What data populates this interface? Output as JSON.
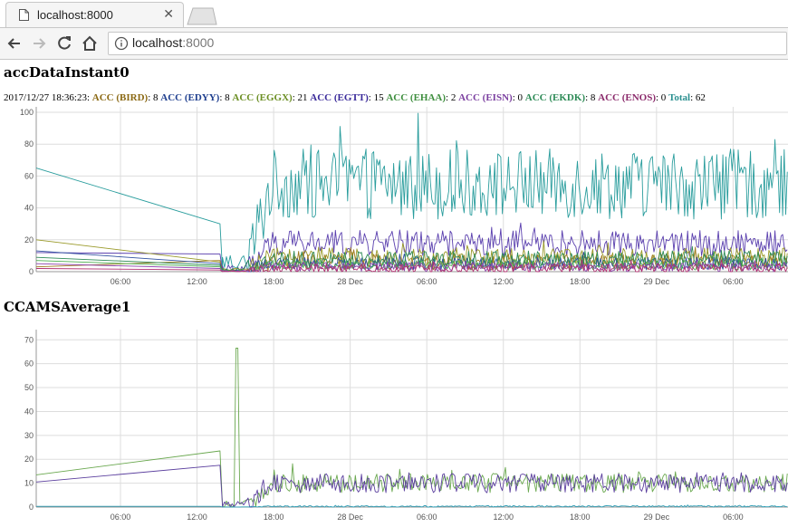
{
  "browser": {
    "tab_title": "localhost:8000",
    "url_host": "localhost",
    "url_port": ":8000"
  },
  "charts": {
    "instant": {
      "title": "accDataInstant0",
      "legend_time": "2017/12/27 18:36:23",
      "legend": [
        {
          "label": "ACC (BIRD)",
          "value": "8",
          "color": "#8b6914"
        },
        {
          "label": "ACC (EDYY)",
          "value": "8",
          "color": "#1f3f8f"
        },
        {
          "label": "ACC (EGGX)",
          "value": "21",
          "color": "#6b8e23"
        },
        {
          "label": "ACC (EGTT)",
          "value": "15",
          "color": "#3a2a9a"
        },
        {
          "label": "ACC (EHAA)",
          "value": "2",
          "color": "#3e8e3e"
        },
        {
          "label": "ACC (EISN)",
          "value": "0",
          "color": "#7b3fa0"
        },
        {
          "label": "ACC (EKDK)",
          "value": "8",
          "color": "#2e8b57"
        },
        {
          "label": "ACC (ENOS)",
          "value": "0",
          "color": "#8b2a6b"
        },
        {
          "label": "Total",
          "value": "62",
          "color": "#2a8f8f"
        }
      ]
    },
    "average": {
      "title": "CCAMSAverage1"
    }
  },
  "chart_data": [
    {
      "type": "line",
      "title": "accDataInstant0",
      "xlabel": "",
      "ylabel": "",
      "x_ticks": [
        "06:00",
        "12:00",
        "18:00",
        "28 Dec",
        "06:00",
        "12:00",
        "18:00",
        "29 Dec",
        "06:00"
      ],
      "x_tick_hours": [
        6,
        12,
        18,
        24,
        30,
        36,
        42,
        48,
        54
      ],
      "xlim": [
        -0.6,
        58.3
      ],
      "ylim": [
        0,
        100
      ],
      "y_ticks": [
        0,
        20,
        40,
        60,
        80,
        100
      ],
      "grid": true,
      "series": [
        {
          "name": "Total",
          "color": "#2a9d9d",
          "start": 65,
          "gap_end": 30,
          "mean": 55,
          "amp": 22,
          "ramp": 50
        },
        {
          "name": "ACC (EGTT)",
          "color": "#5a3fae",
          "start": 12,
          "gap_end": 11,
          "mean": 18,
          "amp": 8,
          "ramp": 18
        },
        {
          "name": "ACC (EGGX)",
          "color": "#9a9a2a",
          "start": 20,
          "gap_end": 6,
          "mean": 9,
          "amp": 6,
          "ramp": 9
        },
        {
          "name": "ACC (BIRD)",
          "color": "#a07a20",
          "start": 3,
          "gap_end": 7,
          "mean": 6,
          "amp": 5,
          "ramp": 6
        },
        {
          "name": "ACC (EDYY)",
          "color": "#3050a0",
          "start": 13,
          "gap_end": 5,
          "mean": 5,
          "amp": 4,
          "ramp": 5
        },
        {
          "name": "ACC (EKDK)",
          "color": "#2e8b57",
          "start": 9,
          "gap_end": 4,
          "mean": 8,
          "amp": 5,
          "ramp": 8
        },
        {
          "name": "ACC (EHAA)",
          "color": "#4caf50",
          "start": 7,
          "gap_end": 3,
          "mean": 4,
          "amp": 3,
          "ramp": 4
        },
        {
          "name": "ACC (EISN)",
          "color": "#8e44ad",
          "start": 5,
          "gap_end": 2,
          "mean": 3,
          "amp": 3,
          "ramp": 3
        },
        {
          "name": "ACC (ENOS)",
          "color": "#b03070",
          "start": 2,
          "gap_end": 1,
          "mean": 2,
          "amp": 3,
          "ramp": 2
        }
      ]
    },
    {
      "type": "line",
      "title": "CCAMSAverage1",
      "xlabel": "",
      "ylabel": "",
      "x_ticks": [
        "06:00",
        "12:00",
        "18:00",
        "28 Dec",
        "06:00",
        "12:00",
        "18:00",
        "29 Dec",
        "06:00"
      ],
      "x_tick_hours": [
        6,
        12,
        18,
        24,
        30,
        36,
        42,
        48,
        54
      ],
      "xlim": [
        -0.6,
        58.3
      ],
      "ylim": [
        0,
        72
      ],
      "y_ticks": [
        0,
        10,
        20,
        30,
        40,
        50,
        60,
        70
      ],
      "grid": true,
      "series": [
        {
          "color": "#6aa84f",
          "start": 13.5,
          "gap_end": 23.5,
          "spike": 66.5,
          "mean": 10,
          "amp": 4
        },
        {
          "color": "#5b3f9e",
          "start": 10.5,
          "gap_end": 17.5,
          "mean": 10,
          "amp": 4
        },
        {
          "color": "#2a9db5",
          "start": 0.3,
          "gap_end": 0.3,
          "mean": 0.3,
          "amp": 0.3
        }
      ]
    }
  ]
}
